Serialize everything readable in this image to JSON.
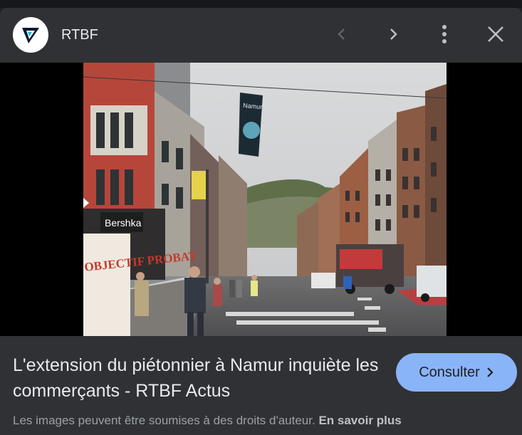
{
  "header": {
    "source_name": "RTBF",
    "icons": {
      "logo": "rtbf-logo-icon",
      "prev": "chevron-left-icon",
      "next": "chevron-right-icon",
      "more": "more-vertical-icon",
      "close": "close-icon"
    }
  },
  "photo": {
    "shop_sign": "Bershka",
    "banner_text": "Namur",
    "placard_text": "OBJECTIF PROBAT"
  },
  "result": {
    "title": "L'extension du piétonnier à Namur inquiète les commerçants - RTBF Actus",
    "consult_label": "Consulter"
  },
  "footer": {
    "rights_text": "Les images peuvent être soumises à des droits d'auteur.",
    "learn_more_label": "En savoir plus"
  },
  "colors": {
    "panel": "#303134",
    "accent": "#8ab4f8",
    "text": "#e8eaed",
    "muted": "#9aa0a6"
  }
}
